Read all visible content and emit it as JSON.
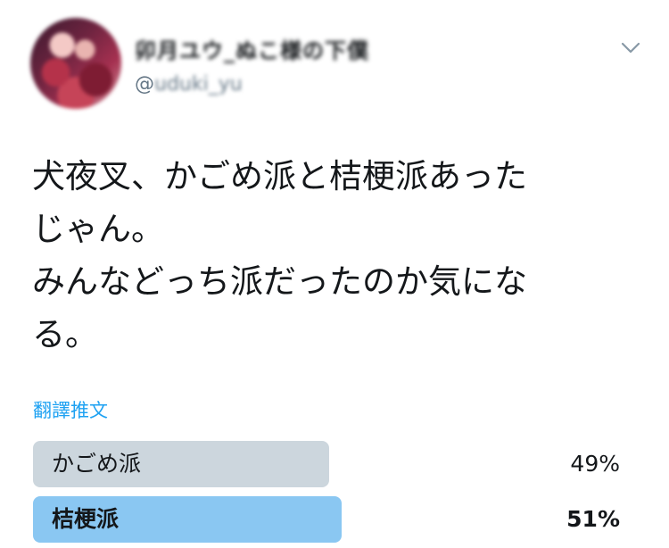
{
  "author": {
    "display_name": "卯月ユウ_ぬこ様の下僕",
    "handle_prefix": "@",
    "handle_rest": "uduki_yu"
  },
  "tweet": {
    "text": "犬夜叉、かごめ派と桔梗派あった\nじゃん。\nみんなどっち派だったのか気にな\nる。",
    "translate_label": "翻譯推文"
  },
  "poll": {
    "options": [
      {
        "label": "かごめ派",
        "percent_text": "49%",
        "percent": 49,
        "leading": false
      },
      {
        "label": "桔梗派",
        "percent_text": "51%",
        "percent": 51,
        "leading": true
      }
    ]
  },
  "icons": {
    "menu": "chevron-down-icon",
    "avatar": "avatar-image"
  },
  "colors": {
    "link": "#1da1f2",
    "poll_bar_default": "#ccd6dd",
    "poll_bar_leading": "#8ac7f2",
    "text": "#14171a",
    "secondary_text": "#657786"
  }
}
